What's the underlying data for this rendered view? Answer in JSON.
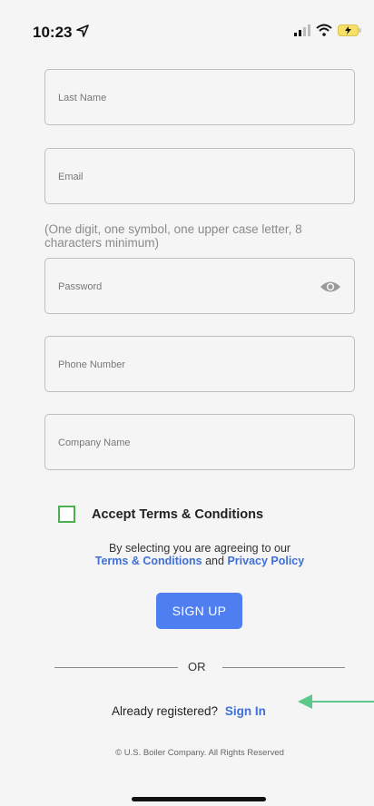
{
  "status_bar": {
    "time": "10:23"
  },
  "form": {
    "last_name_placeholder": "Last Name",
    "email_placeholder": "Email",
    "password_hint": "(One digit, one symbol, one upper case letter, 8 characters minimum)",
    "password_placeholder": "Password",
    "phone_placeholder": "Phone Number",
    "company_placeholder": "Company Name"
  },
  "terms": {
    "accept_label": "Accept Terms & Conditions",
    "agree_text": "By selecting you are agreeing to our",
    "terms_link": "Terms & Conditions",
    "and_text": "and",
    "privacy_link": "Privacy Policy"
  },
  "actions": {
    "signup_label": "SIGN UP",
    "or_label": "OR",
    "already_text": "Already registered?",
    "signin_label": "Sign In"
  },
  "footer": {
    "copyright": "© U.S. Boiler Company. All Rights Reserved"
  },
  "colors": {
    "accent": "#4f7ef0",
    "link": "#3f6fd8",
    "checkbox_border": "#4caf50",
    "annotation_arrow": "#5cc98a"
  }
}
